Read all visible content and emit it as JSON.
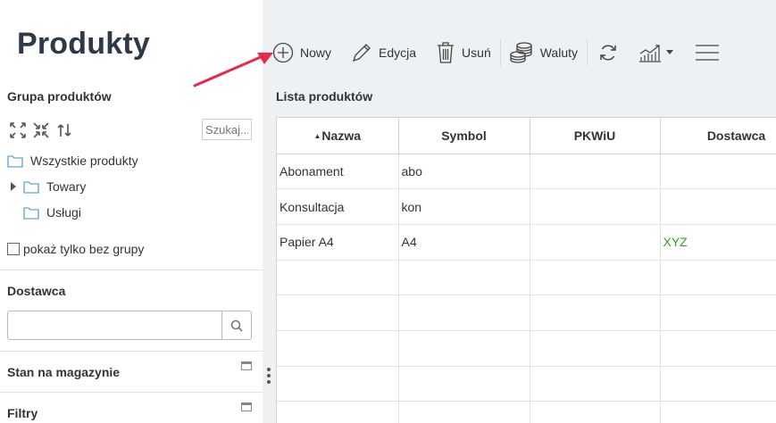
{
  "app": {
    "title": "Produkty"
  },
  "left": {
    "group_title": "Grupa produktów",
    "search_placeholder": "Szukaj...",
    "tree": [
      {
        "label": "Wszystkie produkty"
      },
      {
        "label": "Towary"
      },
      {
        "label": "Usługi"
      }
    ],
    "only_without_group_label": "pokaż tylko bez grupy",
    "supplier_title": "Dostawca",
    "supplier_value": "",
    "stock_title": "Stan na magazynie",
    "filters_title": "Filtry"
  },
  "toolbar": {
    "new_label": "Nowy",
    "edit_label": "Edycja",
    "delete_label": "Usuń",
    "currencies_label": "Waluty"
  },
  "list": {
    "title": "Lista produktów",
    "columns": [
      "Nazwa",
      "Symbol",
      "PKWiU",
      "Dostawca"
    ],
    "rows": [
      [
        "Abonament",
        "abo",
        "",
        ""
      ],
      [
        "Konsultacja",
        "kon",
        "",
        ""
      ],
      [
        "Papier A4",
        "A4",
        "",
        "XYZ"
      ]
    ]
  },
  "colors": {
    "accent": "#e8294b",
    "title": "#2c3a4a",
    "supplier_link": "#3a9a2a",
    "panel_bg": "#eef1f3"
  },
  "icons": [
    "plus-circle-icon",
    "pencil-icon",
    "trash-icon",
    "coins-icon",
    "refresh-icon",
    "chart-icon",
    "hamburger-icon",
    "expand-icon",
    "collapse-icon",
    "reset-icon",
    "folder-icon",
    "search-icon"
  ]
}
